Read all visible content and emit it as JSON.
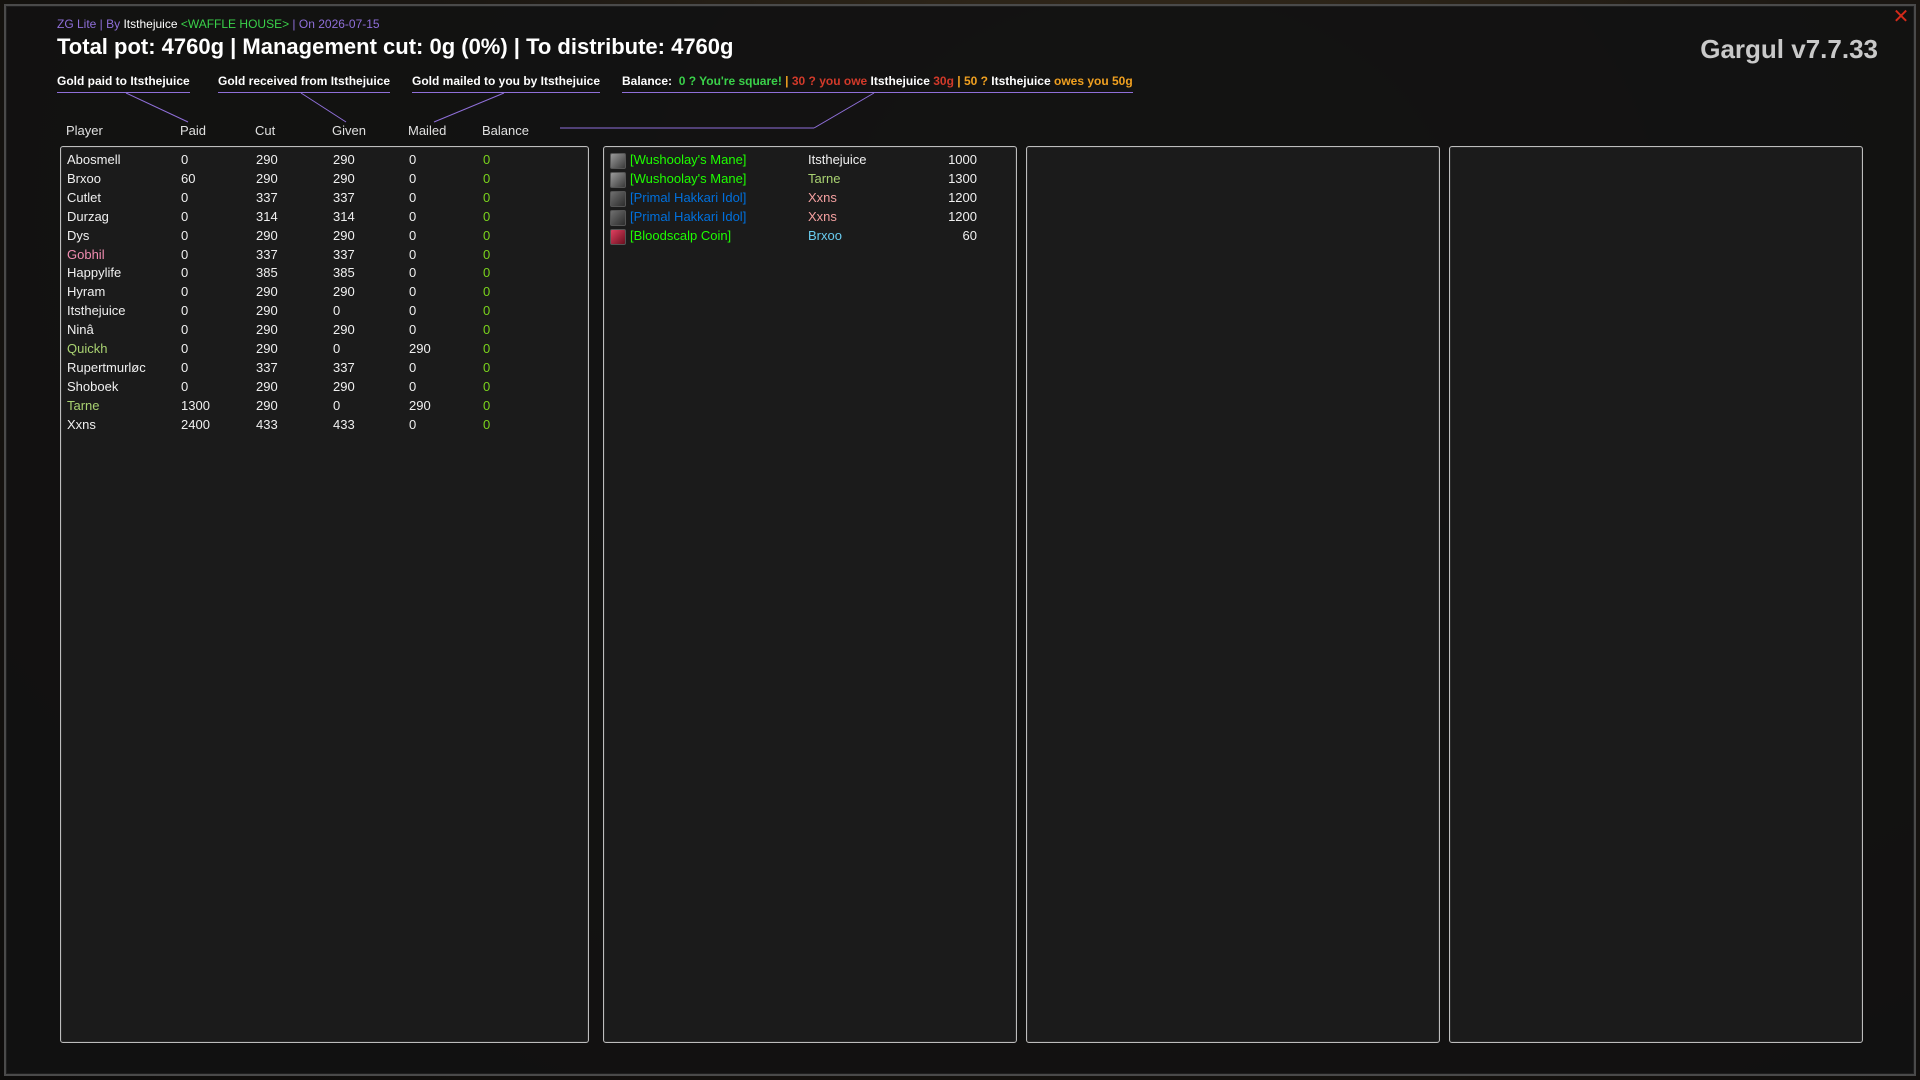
{
  "header": {
    "subtitle_guild": "ZG Lite | By ",
    "subtitle_user": "Itsthejuice",
    "subtitle_tag": " <WAFFLE HOUSE>",
    "subtitle_date": " | On 2026-07-15",
    "title": "Total pot: 4760g | Management cut: 0g (0%) | To distribute: 4760g",
    "version": "Gargul v7.7.33",
    "close": "✕"
  },
  "legend": {
    "paid": "Gold paid to Itsthejuice",
    "received": "Gold received from Itsthejuice",
    "mailed": "Gold mailed to you by Itsthejuice",
    "balance_label": "Balance:",
    "balance_square": "0 ? You're square!",
    "sep1": " | ",
    "balance_owe_prefix": "30 ? you owe ",
    "balance_owe_name": "Itsthejuice",
    "balance_owe_amount": " 30g",
    "sep2": " | ",
    "balance_owed_prefix": "50 ? ",
    "balance_owed_name": "Itsthejuice",
    "balance_owed_suffix": " owes you 50g"
  },
  "columns": {
    "player": "Player",
    "paid": "Paid",
    "cut": "Cut",
    "given": "Given",
    "mailed": "Mailed",
    "balance": "Balance"
  },
  "players": [
    {
      "name": "Abosmell",
      "paid": "0",
      "cut": "290",
      "given": "290",
      "mailed": "0",
      "balance": "0",
      "color": "#f0f0f0"
    },
    {
      "name": "Brxoo",
      "paid": "60",
      "cut": "290",
      "given": "290",
      "mailed": "0",
      "balance": "0",
      "color": "#f0f0f0"
    },
    {
      "name": "Cutlet",
      "paid": "0",
      "cut": "337",
      "given": "337",
      "mailed": "0",
      "balance": "0",
      "color": "#f0f0f0"
    },
    {
      "name": "Durzag",
      "paid": "0",
      "cut": "314",
      "given": "314",
      "mailed": "0",
      "balance": "0",
      "color": "#f0f0f0"
    },
    {
      "name": "Dys",
      "paid": "0",
      "cut": "290",
      "given": "290",
      "mailed": "0",
      "balance": "0",
      "color": "#f0f0f0"
    },
    {
      "name": "Gobhil",
      "paid": "0",
      "cut": "337",
      "given": "337",
      "mailed": "0",
      "balance": "0",
      "color": "#f08cb0"
    },
    {
      "name": "Happylife",
      "paid": "0",
      "cut": "385",
      "given": "385",
      "mailed": "0",
      "balance": "0",
      "color": "#f0f0f0"
    },
    {
      "name": "Hyram",
      "paid": "0",
      "cut": "290",
      "given": "290",
      "mailed": "0",
      "balance": "0",
      "color": "#f0f0f0"
    },
    {
      "name": "Itsthejuice",
      "paid": "0",
      "cut": "290",
      "given": "0",
      "mailed": "0",
      "balance": "0",
      "color": "#f0f0f0"
    },
    {
      "name": "Ninâ",
      "paid": "0",
      "cut": "290",
      "given": "290",
      "mailed": "0",
      "balance": "0",
      "color": "#f0f0f0"
    },
    {
      "name": "Quickh",
      "paid": "0",
      "cut": "290",
      "given": "0",
      "mailed": "290",
      "balance": "0",
      "color": "#a9d271"
    },
    {
      "name": "Rupertmurløc",
      "paid": "0",
      "cut": "337",
      "given": "337",
      "mailed": "0",
      "balance": "0",
      "color": "#f0f0f0"
    },
    {
      "name": "Shoboek",
      "paid": "0",
      "cut": "290",
      "given": "290",
      "mailed": "0",
      "balance": "0",
      "color": "#f0f0f0"
    },
    {
      "name": "Tarne",
      "paid": "1300",
      "cut": "290",
      "given": "0",
      "mailed": "290",
      "balance": "0",
      "color": "#a9d271"
    },
    {
      "name": "Xxns",
      "paid": "2400",
      "cut": "433",
      "given": "433",
      "mailed": "0",
      "balance": "0",
      "color": "#f0f0f0"
    }
  ],
  "items": [
    {
      "icon": "mane-icon",
      "name": "[Wushoolay's Mane]",
      "name_color": "#1eff00",
      "winner": "Itsthejuice",
      "winner_color": "#f0f0f0",
      "price": "1000"
    },
    {
      "icon": "mane-icon",
      "name": "[Wushoolay's Mane]",
      "name_color": "#1eff00",
      "winner": "Tarne",
      "winner_color": "#a9d271",
      "price": "1300"
    },
    {
      "icon": "idol-icon",
      "name": "[Primal Hakkari Idol]",
      "name_color": "#0070dd",
      "winner": "Xxns",
      "winner_color": "#f4a0a0",
      "price": "1200"
    },
    {
      "icon": "idol-icon",
      "name": "[Primal Hakkari Idol]",
      "name_color": "#0070dd",
      "winner": "Xxns",
      "winner_color": "#f4a0a0",
      "price": "1200"
    },
    {
      "icon": "coin-icon",
      "name": "[Bloodscalp Coin]",
      "name_color": "#1eff00",
      "winner": "Brxoo",
      "winner_color": "#69ccf0",
      "price": "60"
    }
  ],
  "colors": {
    "accent_purple": "#8f6fd9",
    "balance_green": "#7ad31c",
    "uncommon": "#1eff00",
    "rare": "#0070dd"
  }
}
